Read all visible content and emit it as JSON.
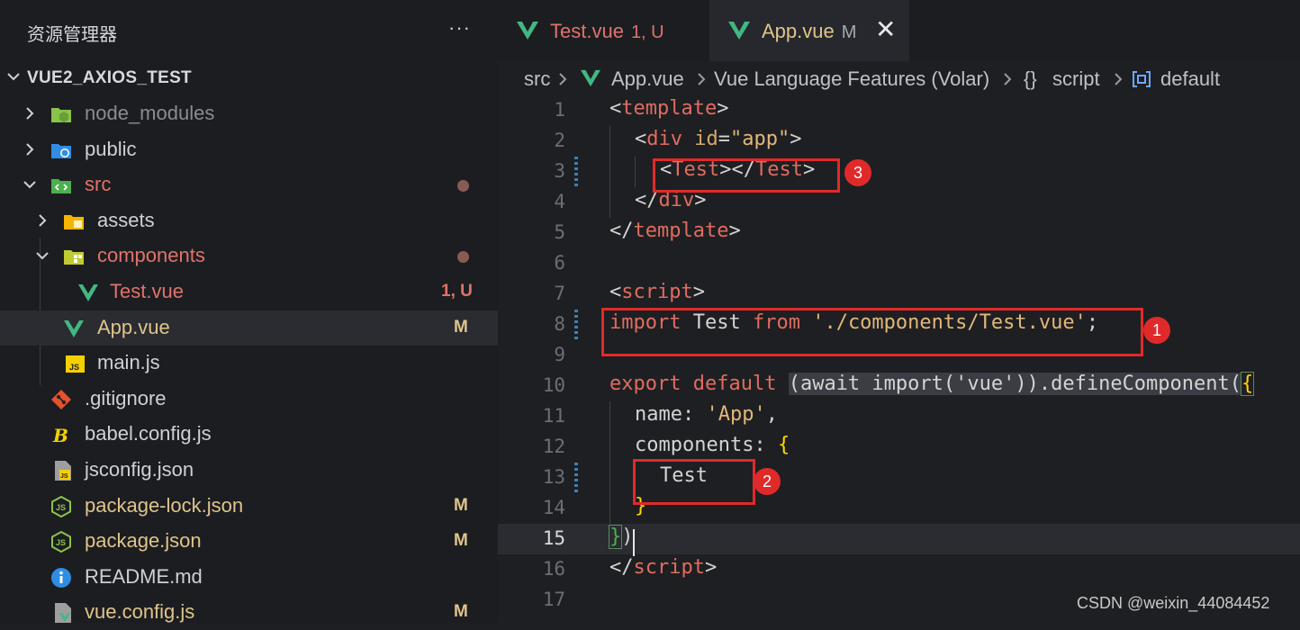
{
  "explorer": {
    "title": "资源管理器",
    "more_label": "···",
    "project_name": "VUE2_AXIOS_TEST",
    "items": [
      {
        "label": "node_modules",
        "badge": "",
        "color": "#8b8c90"
      },
      {
        "label": "public",
        "badge": "",
        "color": "#cfd0d3"
      },
      {
        "label": "src",
        "badge": "",
        "color": "#e0736a"
      },
      {
        "label": "assets",
        "badge": "",
        "color": "#cfd0d3"
      },
      {
        "label": "components",
        "badge": "",
        "color": "#e0736a"
      },
      {
        "label": "Test.vue",
        "badge": "1, U",
        "color": "#e0736a"
      },
      {
        "label": "App.vue",
        "badge": "M",
        "color": "#e0c48a"
      },
      {
        "label": "main.js",
        "badge": "",
        "color": "#cfd0d3"
      },
      {
        "label": ".gitignore",
        "badge": "",
        "color": "#cfd0d3"
      },
      {
        "label": "babel.config.js",
        "badge": "",
        "color": "#cfd0d3"
      },
      {
        "label": "jsconfig.json",
        "badge": "",
        "color": "#cfd0d3"
      },
      {
        "label": "package-lock.json",
        "badge": "M",
        "color": "#e0c48a"
      },
      {
        "label": "package.json",
        "badge": "M",
        "color": "#e0c48a"
      },
      {
        "label": "README.md",
        "badge": "",
        "color": "#cfd0d3"
      },
      {
        "label": "vue.config.js",
        "badge": "M",
        "color": "#e0c48a"
      }
    ]
  },
  "tabs": [
    {
      "label": "Test.vue",
      "status": "1, U"
    },
    {
      "label": "App.vue",
      "status": "M"
    }
  ],
  "tab_close_label": "✕",
  "breadcrumb": {
    "src": "src",
    "file": "App.vue",
    "lang": "Vue Language Features (Volar)",
    "braces": "{}",
    "script": "script",
    "symbol": "default"
  },
  "line_numbers": [
    "1",
    "2",
    "3",
    "4",
    "5",
    "6",
    "7",
    "8",
    "9",
    "10",
    "11",
    "12",
    "13",
    "14",
    "15",
    "16",
    "17"
  ],
  "code": {
    "l1": {
      "open": "<",
      "tag": "template",
      "close": ">"
    },
    "l2": {
      "open": "<",
      "tag": "div",
      "attr": "id",
      "eq": "=",
      "val": "\"app\"",
      "close": ">"
    },
    "l3": {
      "o1": "<",
      "tag1": "Test",
      "c1": "></",
      "tag2": "Test",
      "c2": ">"
    },
    "l4": {
      "open": "</",
      "tag": "div",
      "close": ">"
    },
    "l5": {
      "open": "</",
      "tag": "template",
      "close": ">"
    },
    "l7": {
      "open": "<",
      "tag": "script",
      "close": ">"
    },
    "l8": {
      "kw1": "import",
      "id": " Test ",
      "kw2": "from",
      "sp": " ",
      "str": "'./components/Test.vue'",
      "end": ";"
    },
    "l10": {
      "kw1": "export",
      "sp1": " ",
      "kw2": "default",
      "sp2": " ",
      "hl": "(await import('vue')).defineComponent(",
      "brace": "{"
    },
    "l11": {
      "key": "name: ",
      "str": "'App'",
      "end": ","
    },
    "l12": {
      "key": "components: ",
      "brace": "{"
    },
    "l13": {
      "id": "Test"
    },
    "l14": {
      "brace": "}"
    },
    "l15": {
      "brace": "}",
      "paren": ")"
    },
    "l16": {
      "open": "</",
      "tag": "script",
      "close": ">"
    }
  },
  "annotations": [
    "1",
    "2",
    "3"
  ],
  "watermark": "CSDN @weixin_44084452"
}
